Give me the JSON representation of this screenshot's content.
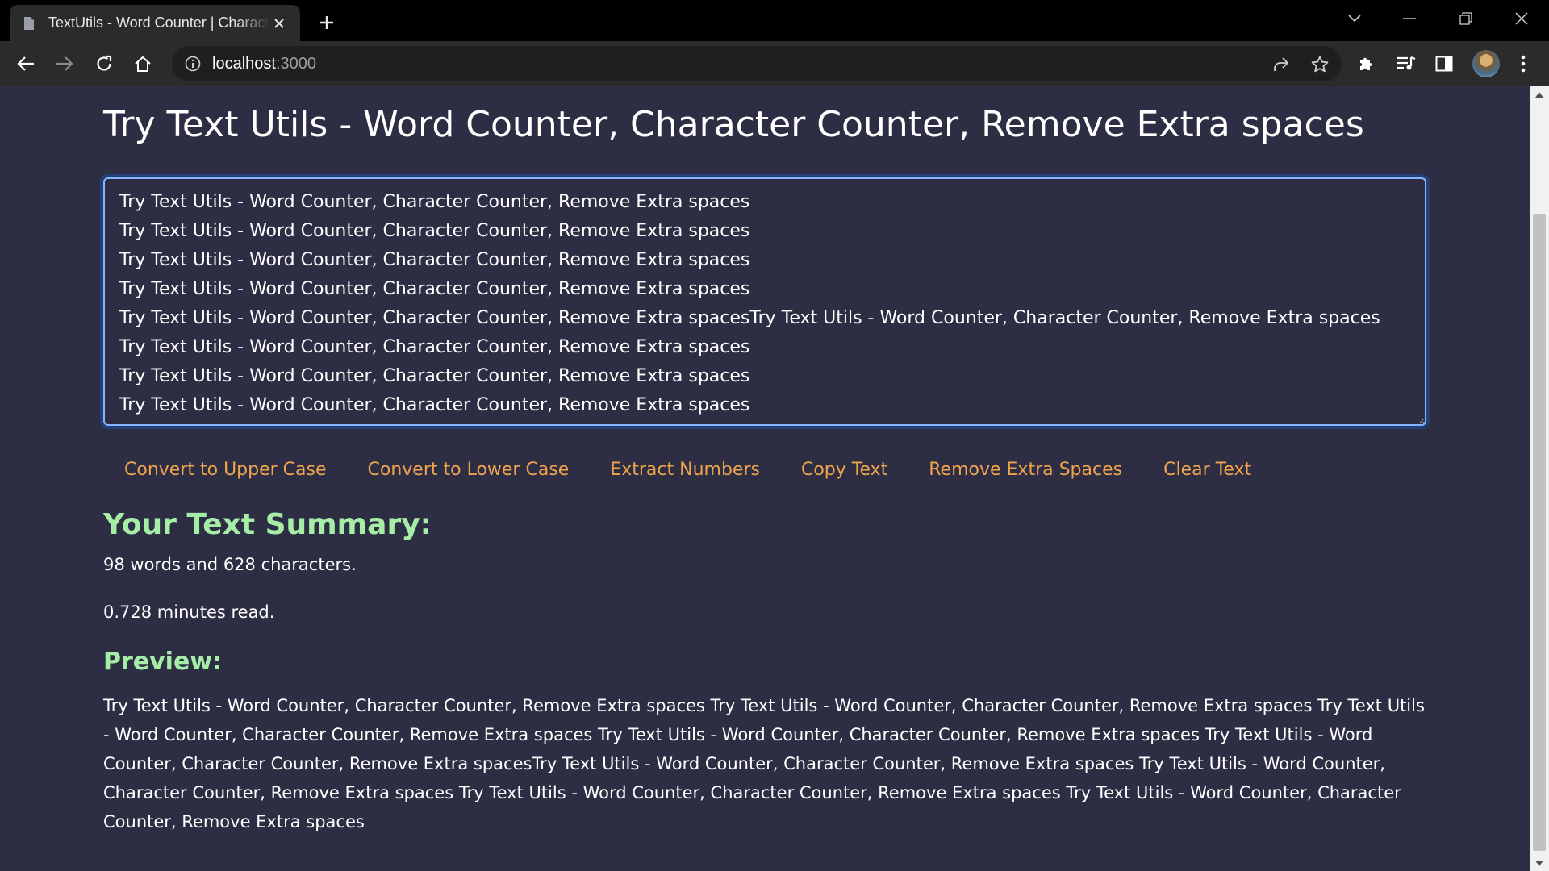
{
  "browser": {
    "tab_title": "TextUtils - Word Counter | Character Counter",
    "url_host": "localhost",
    "url_port": ":3000"
  },
  "page": {
    "title": "Try Text Utils - Word Counter, Character Counter, Remove Extra spaces",
    "textarea_value": "Try Text Utils - Word Counter, Character Counter, Remove Extra spaces\nTry Text Utils - Word Counter, Character Counter, Remove Extra spaces\nTry Text Utils - Word Counter, Character Counter, Remove Extra spaces\nTry Text Utils - Word Counter, Character Counter, Remove Extra spaces\nTry Text Utils - Word Counter, Character Counter, Remove Extra spacesTry Text Utils - Word Counter, Character Counter, Remove Extra spaces\nTry Text Utils - Word Counter, Character Counter, Remove Extra spaces\nTry Text Utils - Word Counter, Character Counter, Remove Extra spaces\nTry Text Utils - Word Counter, Character Counter, Remove Extra spaces",
    "buttons": {
      "upper": "Convert to Upper Case",
      "lower": "Convert to Lower Case",
      "numbers": "Extract Numbers",
      "copy": "Copy Text",
      "spaces": "Remove Extra Spaces",
      "clear": "Clear Text"
    },
    "summary": {
      "heading": "Your Text Summary:",
      "counts": "98 words and 628 characters.",
      "read_time": "0.728 minutes read."
    },
    "preview": {
      "heading": "Preview:",
      "text": "Try Text Utils - Word Counter, Character Counter, Remove Extra spaces Try Text Utils - Word Counter, Character Counter, Remove Extra spaces Try Text Utils - Word Counter, Character Counter, Remove Extra spaces Try Text Utils - Word Counter, Character Counter, Remove Extra spaces Try Text Utils - Word Counter, Character Counter, Remove Extra spacesTry Text Utils - Word Counter, Character Counter, Remove Extra spaces Try Text Utils - Word Counter, Character Counter, Remove Extra spaces Try Text Utils - Word Counter, Character Counter, Remove Extra spaces Try Text Utils - Word Counter, Character Counter, Remove Extra spaces"
    }
  },
  "colors": {
    "page_bg": "#2d2e43",
    "button_text": "#f0a44e",
    "heading_green": "#a6eea6",
    "focus_border": "#86b7fe"
  },
  "icons": {
    "tab": [
      "page-favicon-icon",
      "close-icon",
      "plus-icon"
    ],
    "window": [
      "chevron-down-icon",
      "minimize-icon",
      "restore-icon",
      "close-icon"
    ],
    "nav": [
      "back-arrow-icon",
      "forward-arrow-icon",
      "reload-icon",
      "home-icon",
      "info-icon"
    ],
    "toolbar": [
      "share-icon",
      "star-icon",
      "puzzle-icon",
      "media-queue-icon",
      "side-panel-icon"
    ]
  }
}
